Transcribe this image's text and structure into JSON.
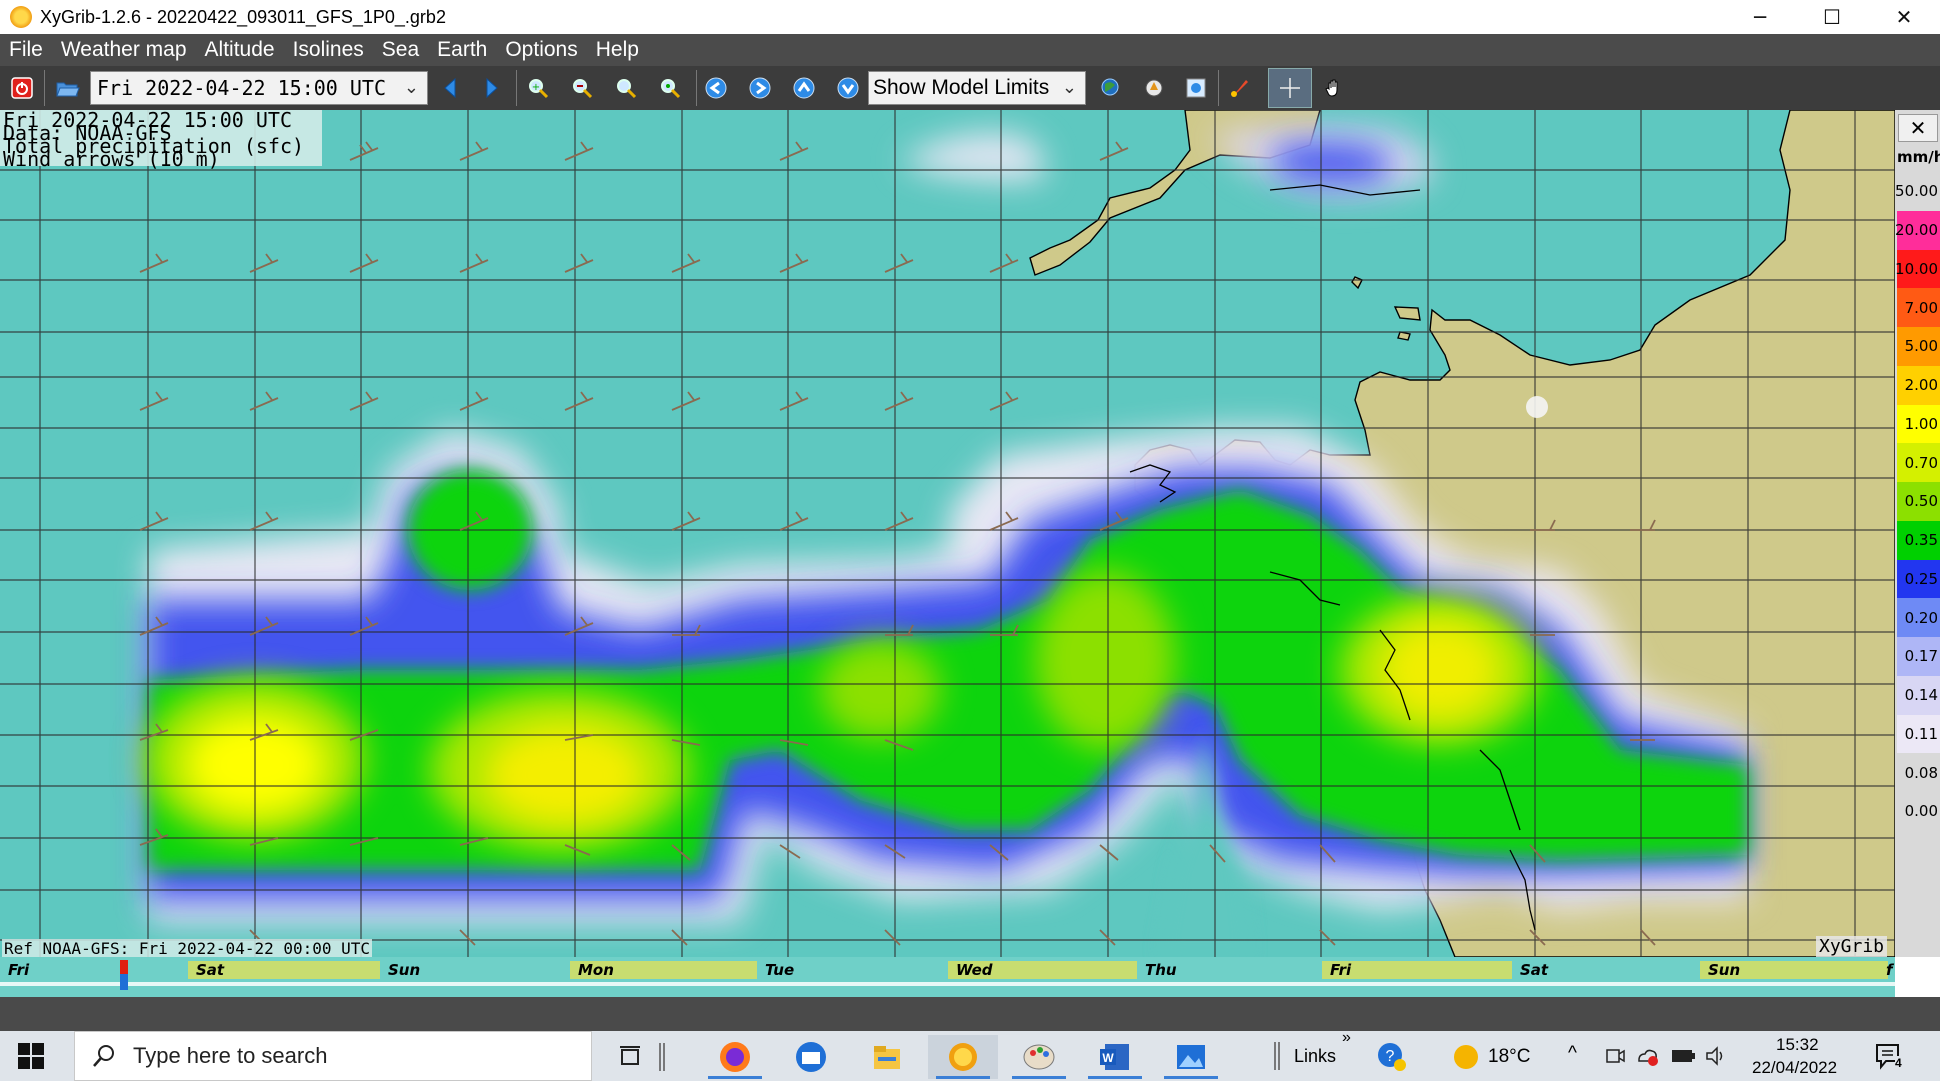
{
  "window": {
    "title": "XyGrib-1.2.6 - 20220422_093011_GFS_1P0_.grb2",
    "controls": {
      "minimize": "─",
      "maximize": "☐",
      "close": "✕"
    }
  },
  "menubar": {
    "items": [
      "File",
      "Weather map",
      "Altitude",
      "Isolines",
      "Sea",
      "Earth",
      "Options",
      "Help"
    ]
  },
  "toolbar": {
    "date_value": "Fri 2022-04-22 15:00 UTC",
    "model_limits_value": "Show Model Limits",
    "icons": [
      "quit-icon",
      "open-file-icon",
      "previous-date-icon",
      "next-date-icon",
      "zoom-in-icon",
      "zoom-out-icon",
      "zoom-selection-icon",
      "zoom-all-icon",
      "pan-left-icon",
      "pan-right-icon",
      "pan-up-icon",
      "pan-down-icon",
      "download-icon",
      "location-icon",
      "meteotable-icon",
      "rocket-icon",
      "crosshair-icon",
      "hand-icon"
    ]
  },
  "map": {
    "info": {
      "line1": "Fri 2022-04-22 15:00 UTC",
      "line2": "Data: NOAA-GFS",
      "line3": "Total precipitation (sfc)",
      "line4": "Wind arrows (10 m)"
    },
    "ref_text": "Ref NOAA-GFS: Fri 2022-04-22 00:00 UTC",
    "watermark": "XyGrib"
  },
  "legend": {
    "close_label": "✕",
    "unit": "mm/h",
    "entries": [
      {
        "label": "50.00",
        "color": "#d9d9d9"
      },
      {
        "label": "20.00",
        "color": "#ff2d9a"
      },
      {
        "label": "10.00",
        "color": "#ff1a1a"
      },
      {
        "label": "7.00",
        "color": "#ff5a14"
      },
      {
        "label": "5.00",
        "color": "#ff9a00"
      },
      {
        "label": "2.00",
        "color": "#ffd000"
      },
      {
        "label": "1.00",
        "color": "#ffff00"
      },
      {
        "label": "0.70",
        "color": "#d4f000"
      },
      {
        "label": "0.50",
        "color": "#8ce000"
      },
      {
        "label": "0.35",
        "color": "#00d000"
      },
      {
        "label": "0.25",
        "color": "#2236f0"
      },
      {
        "label": "0.20",
        "color": "#6e8af5"
      },
      {
        "label": "0.17",
        "color": "#aeb6f6"
      },
      {
        "label": "0.14",
        "color": "#d8d6f4"
      },
      {
        "label": "0.11",
        "color": "#ece8f6"
      },
      {
        "label": "0.08",
        "color": "#d9d9d9"
      },
      {
        "label": "0.00",
        "color": "#d9d9d9"
      }
    ]
  },
  "timeline": {
    "days": [
      "Fri",
      "Sat",
      "Sun",
      "Mon",
      "Tue",
      "Wed",
      "Thu",
      "Fri",
      "Sat",
      "Sun"
    ],
    "end_mark": "f"
  },
  "taskbar": {
    "search_placeholder": "Type here to search",
    "links_label": "Links",
    "links_chevron": "»",
    "weather_temp": "18°C",
    "time": "15:32",
    "date": "22/04/2022",
    "notification_count": "4",
    "tray_chevron": "^"
  },
  "colors": {
    "sea": "#5ec8c0",
    "land": "#cfc98a",
    "menubar": "#4b4b4b",
    "toolbar": "#3c3c3c"
  }
}
